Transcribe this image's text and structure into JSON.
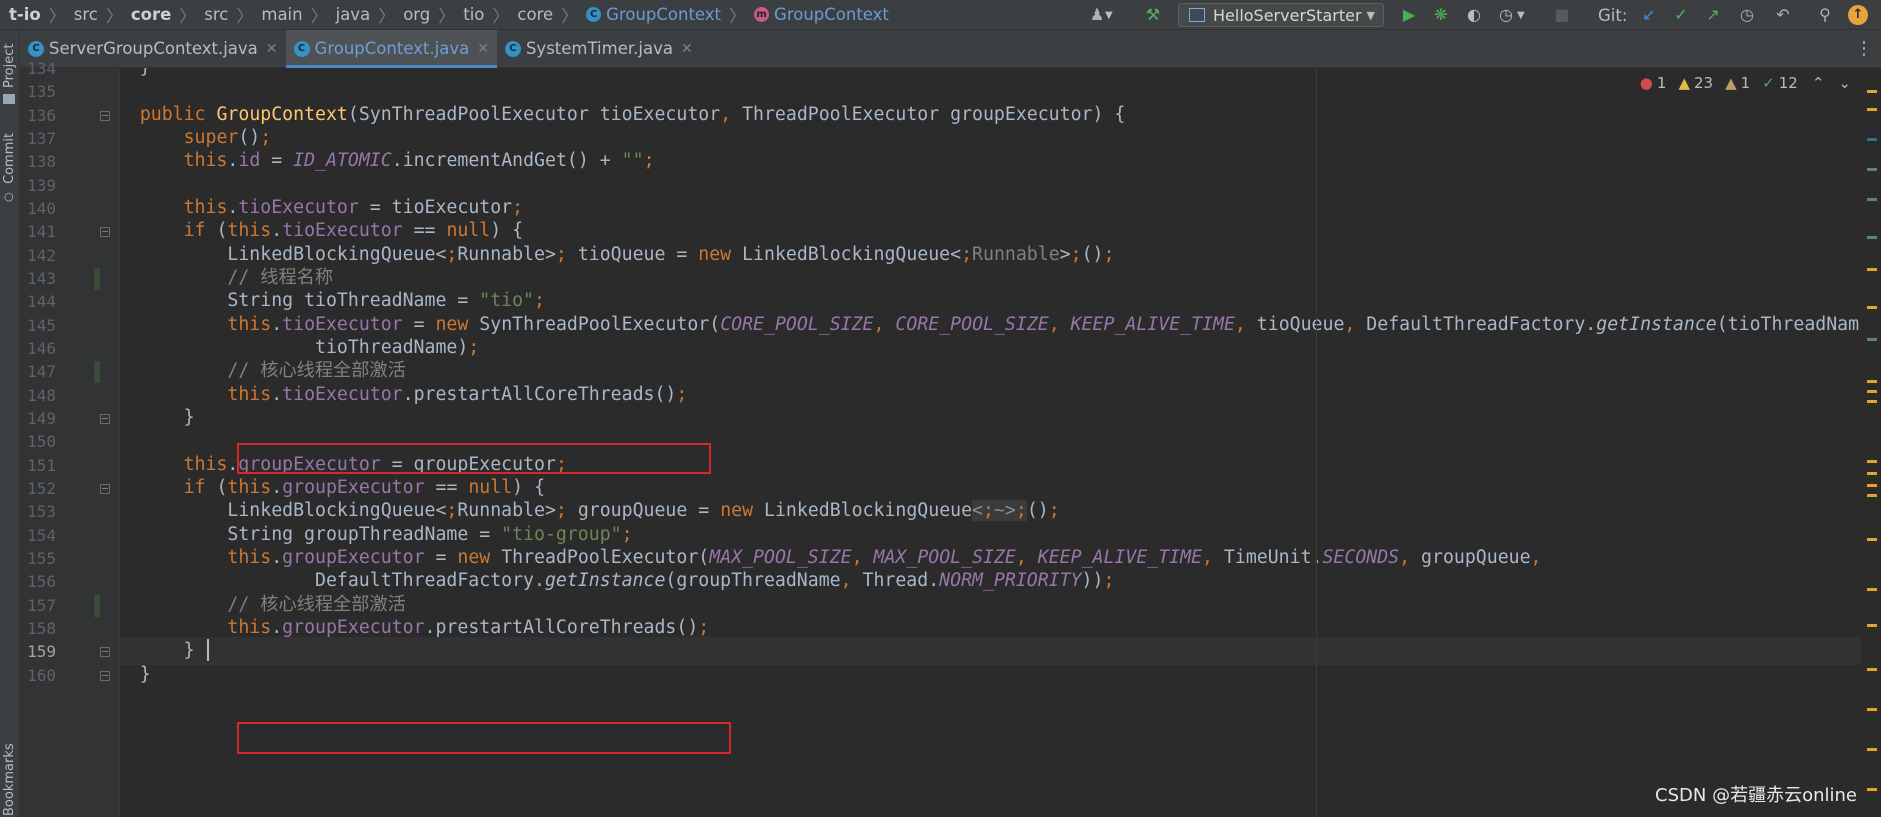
{
  "breadcrumbs": [
    {
      "label": "t-io",
      "bold": true
    },
    {
      "label": "src"
    },
    {
      "label": "core",
      "bold": true
    },
    {
      "label": "src"
    },
    {
      "label": "main"
    },
    {
      "label": "java"
    },
    {
      "label": "org"
    },
    {
      "label": "tio"
    },
    {
      "label": "core"
    },
    {
      "label": "GroupContext",
      "icon": "class-icon",
      "link": true
    },
    {
      "label": "GroupContext",
      "icon": "method-icon",
      "link": true
    }
  ],
  "toolbar": {
    "run_configuration": "HelloServerStarter",
    "git_label": "Git:",
    "icons": [
      "user-icon",
      "build-hammer-icon",
      "run-icon",
      "debug-icon",
      "coverage-icon",
      "profile-icon",
      "stop-icon",
      "git-update-icon",
      "git-commit-icon",
      "git-push-icon",
      "history-icon",
      "rollback-icon",
      "search-icon",
      "update-notification-icon"
    ]
  },
  "tabs": [
    {
      "label": "ServerGroupContext.java",
      "active": false
    },
    {
      "label": "GroupContext.java",
      "active": true
    },
    {
      "label": "SystemTimer.java",
      "active": false
    }
  ],
  "side_tools": {
    "project": "Project",
    "commit": "Commit",
    "bookmarks": "Bookmarks"
  },
  "inspections": {
    "errors": "1",
    "warnings": "23",
    "weak_warnings": "1",
    "typos": "12"
  },
  "colors": {
    "keyword": "#cc7832",
    "method": "#ffc66d",
    "field": "#9876aa",
    "string": "#6a8759",
    "comment": "#808080",
    "highlight_box": "#d9262b"
  },
  "code_lines": [
    {
      "num": "134",
      "text": "    }"
    },
    {
      "num": "135",
      "text": ""
    },
    {
      "num": "136",
      "text": "    public GroupContext(SynThreadPoolExecutor tioExecutor, ThreadPoolExecutor groupExecutor) {"
    },
    {
      "num": "137",
      "text": "        super();"
    },
    {
      "num": "138",
      "text": "        this.id = ID_ATOMIC.incrementAndGet() + \"\";"
    },
    {
      "num": "139",
      "text": ""
    },
    {
      "num": "140",
      "text": "        this.tioExecutor = tioExecutor;"
    },
    {
      "num": "141",
      "text": "        if (this.tioExecutor == null) {"
    },
    {
      "num": "142",
      "text": "            LinkedBlockingQueue<Runnable> tioQueue = new LinkedBlockingQueue<Runnable>();"
    },
    {
      "num": "143",
      "text": "            // 线程名称"
    },
    {
      "num": "144",
      "text": "            String tioThreadName = \"tio\";"
    },
    {
      "num": "145",
      "text": "            this.tioExecutor = new SynThreadPoolExecutor(CORE_POOL_SIZE, CORE_POOL_SIZE, KEEP_ALIVE_TIME, tioQueue, DefaultThreadFactory.getInstance(tioThreadNam"
    },
    {
      "num": "146",
      "text": "                    tioThreadName);"
    },
    {
      "num": "147",
      "text": "            // 核心线程全部激活"
    },
    {
      "num": "148",
      "text": "            this.tioExecutor.prestartAllCoreThreads();"
    },
    {
      "num": "149",
      "text": "        }"
    },
    {
      "num": "150",
      "text": ""
    },
    {
      "num": "151",
      "text": "        this.groupExecutor = groupExecutor;"
    },
    {
      "num": "152",
      "text": "        if (this.groupExecutor == null) {"
    },
    {
      "num": "153",
      "text": "            LinkedBlockingQueue<Runnable> groupQueue = new LinkedBlockingQueue<~>();"
    },
    {
      "num": "154",
      "text": "            String groupThreadName = \"tio-group\";"
    },
    {
      "num": "155",
      "text": "            this.groupExecutor = new ThreadPoolExecutor(MAX_POOL_SIZE, MAX_POOL_SIZE, KEEP_ALIVE_TIME, TimeUnit.SECONDS, groupQueue,"
    },
    {
      "num": "156",
      "text": "                    DefaultThreadFactory.getInstance(groupThreadName, Thread.NORM_PRIORITY));"
    },
    {
      "num": "157",
      "text": "            // 核心线程全部激活"
    },
    {
      "num": "158",
      "text": "            this.groupExecutor.prestartAllCoreThreads();"
    },
    {
      "num": "159",
      "text": "        }"
    },
    {
      "num": "160",
      "text": "    }"
    }
  ],
  "current_line": "159",
  "watermark": "CSDN @若疆赤云online"
}
